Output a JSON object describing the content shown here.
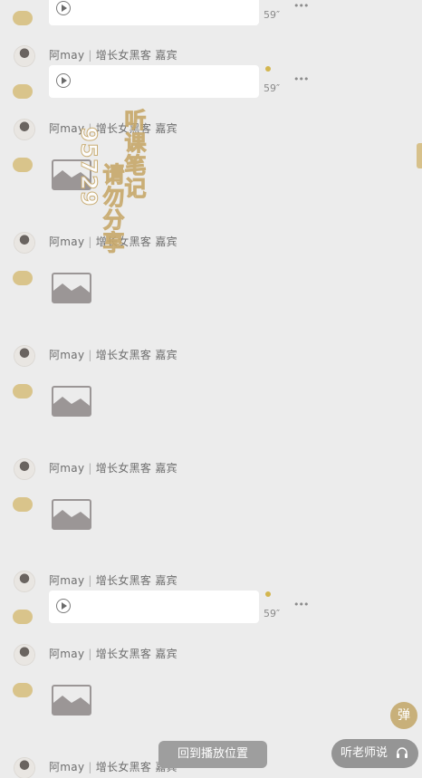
{
  "sender": {
    "name": "阿may",
    "separator": "|",
    "title": "增长女黑客",
    "role": "嘉宾"
  },
  "audio": {
    "duration": "59″",
    "more": "•••"
  },
  "watermark": {
    "col1": "听课笔记",
    "col2": "请勿分享",
    "col3": "95729"
  },
  "controls": {
    "danmu": "弹",
    "return_to_playback": "回到播放位置",
    "listen_teacher": "听老师说"
  },
  "colors": {
    "accent": "#d3b64f",
    "badge": "#d9c48b",
    "background": "#ececec"
  }
}
